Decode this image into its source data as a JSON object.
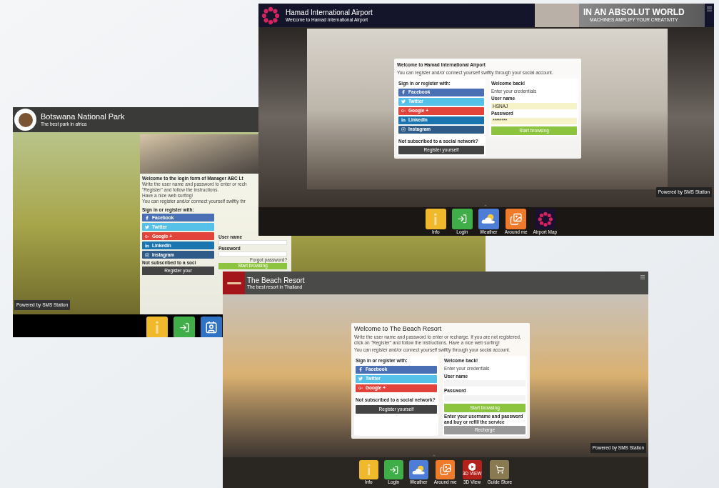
{
  "park_portal": {
    "title": "Botswana National Park",
    "subtitle": "The best park in africa",
    "form": {
      "heading": "Welcome to the login form of Manager ABC Lt",
      "intro": [
        "Write the user name and password to enter or rech",
        "\"Register\" and follow the instructions.",
        "Have a nice web surfing!",
        "You can register and/or connect yourself swiftly thr"
      ],
      "social_heading": "Sign in or register with:",
      "social_buttons": [
        {
          "kind": "facebook",
          "label": "Facebook"
        },
        {
          "kind": "twitter",
          "label": "Twitter"
        },
        {
          "kind": "google",
          "label": "Google +"
        },
        {
          "kind": "linkedin",
          "label": "LinkedIn"
        },
        {
          "kind": "instagram",
          "label": "Instagram"
        }
      ],
      "no_social_text": "Not subscribed to a soci",
      "register_button": "Register your",
      "username_label": "User name",
      "password_label": "Password",
      "forgot_link": "Forgot password?",
      "start_button": "Start browsing"
    },
    "powered_by": "Powered by SMS Station",
    "tiles": [
      {
        "kind": "info"
      },
      {
        "kind": "login"
      },
      {
        "kind": "contact"
      }
    ]
  },
  "airport_portal": {
    "title": "Hamad International Airport",
    "subtitle": "Welcome to Hamad International Airport",
    "ad": {
      "headline": "IN AN ABSOLUT WORLD",
      "tagline": "MACHINES AMPLIFY YOUR CREATIVITY"
    },
    "form": {
      "heading": "Welcome to Hamad International Airport",
      "intro": [
        "You can register and/or connect yourself swiftly through your social account."
      ],
      "social_heading": "Sign in or register with:",
      "social_buttons": [
        {
          "kind": "facebook",
          "label": "Facebook"
        },
        {
          "kind": "twitter",
          "label": "Twitter"
        },
        {
          "kind": "google",
          "label": "Google +"
        },
        {
          "kind": "linkedin",
          "label": "LinkedIn"
        },
        {
          "kind": "instagram",
          "label": "Instagram"
        }
      ],
      "no_social_text": "Not subscribed to a social network?",
      "register_button": "Register yourself",
      "login": {
        "greeting": "Welcome back!",
        "hint": "Enter your credentials",
        "username_label": "User name",
        "username_value": "HSNAJ",
        "password_label": "Password",
        "password_value": "********",
        "start_button": "Start browsing"
      }
    },
    "powered_by": "Powered by SMS Station",
    "tiles": [
      {
        "kind": "info",
        "label": "Info"
      },
      {
        "kind": "login",
        "label": "Login"
      },
      {
        "kind": "weather",
        "label": "Weather"
      },
      {
        "kind": "around",
        "label": "Around me"
      },
      {
        "kind": "map",
        "label": "Airport Map"
      }
    ]
  },
  "resort_portal": {
    "title": "The Beach Resort",
    "subtitle": "The best resort in Thailand",
    "form": {
      "heading": "Welcome to The Beach Resort",
      "intro": [
        "Write the user name and password to enter or recharge. If you are not registered, click on \"Register\" and follow the instructions. Have a nice web surfing!",
        "You can register and/or connect yourself swiftly through your social account."
      ],
      "social_heading": "Sign in or register with:",
      "social_buttons": [
        {
          "kind": "facebook",
          "label": "Facebook"
        },
        {
          "kind": "twitter",
          "label": "Twitter"
        },
        {
          "kind": "google",
          "label": "Google +"
        }
      ],
      "no_social_text": "Not subscribed to a social network?",
      "register_button": "Register yourself",
      "login": {
        "greeting": "Welcome back!",
        "hint": "Enter your credentials",
        "username_label": "User name",
        "password_label": "Password",
        "start_button": "Start browsing",
        "recharge_text": "Enter your username and password and buy or refill the service",
        "recharge_button": "Recharge"
      }
    },
    "powered_by": "Powered by SMS Station",
    "tiles": [
      {
        "kind": "info",
        "label": "Info"
      },
      {
        "kind": "login",
        "label": "Login"
      },
      {
        "kind": "weather",
        "label": "Weather"
      },
      {
        "kind": "around",
        "label": "Around me"
      },
      {
        "kind": "view3d",
        "label": "3D View",
        "icon_text": "3D VIEW"
      },
      {
        "kind": "store",
        "label": "Guide Store"
      }
    ]
  }
}
